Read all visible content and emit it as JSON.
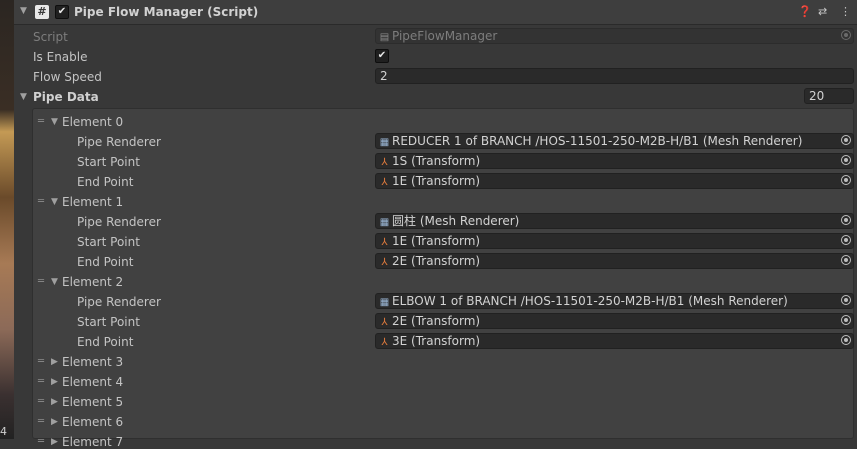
{
  "component": {
    "title": "Pipe Flow Manager (Script)",
    "enabled": true,
    "icons": {
      "help": "question-circle-icon",
      "presets": "sliders-icon",
      "menu": "kebab-menu-icon"
    }
  },
  "fields": {
    "script": {
      "label": "Script",
      "value": "PipeFlowManager"
    },
    "is_enable": {
      "label": "Is Enable",
      "checked": true
    },
    "flow_speed": {
      "label": "Flow Speed",
      "value": "2"
    },
    "pipe_data": {
      "label": "Pipe Data",
      "size": "20"
    }
  },
  "elements": [
    {
      "label": "Element 0",
      "expanded": true,
      "props": [
        {
          "label": "Pipe Renderer",
          "value": "REDUCER 1 of BRANCH /HOS-11501-250-M2B-H/B1 (Mesh Renderer)",
          "icon": "mesh-renderer-icon"
        },
        {
          "label": "Start Point",
          "value": "1S (Transform)",
          "icon": "transform-icon"
        },
        {
          "label": "End Point",
          "value": "1E (Transform)",
          "icon": "transform-icon"
        }
      ]
    },
    {
      "label": "Element 1",
      "expanded": true,
      "props": [
        {
          "label": "Pipe Renderer",
          "value": "圆柱 (Mesh Renderer)",
          "icon": "mesh-renderer-icon"
        },
        {
          "label": "Start Point",
          "value": "1E (Transform)",
          "icon": "transform-icon"
        },
        {
          "label": "End Point",
          "value": "2E (Transform)",
          "icon": "transform-icon"
        }
      ]
    },
    {
      "label": "Element 2",
      "expanded": true,
      "props": [
        {
          "label": "Pipe Renderer",
          "value": "ELBOW 1 of BRANCH /HOS-11501-250-M2B-H/B1 (Mesh Renderer)",
          "icon": "mesh-renderer-icon"
        },
        {
          "label": "Start Point",
          "value": "2E (Transform)",
          "icon": "transform-icon"
        },
        {
          "label": "End Point",
          "value": "3E (Transform)",
          "icon": "transform-icon"
        }
      ]
    },
    {
      "label": "Element 3",
      "expanded": false
    },
    {
      "label": "Element 4",
      "expanded": false
    },
    {
      "label": "Element 5",
      "expanded": false
    },
    {
      "label": "Element 6",
      "expanded": false
    },
    {
      "label": "Element 7",
      "expanded": false
    }
  ],
  "scene_view": {
    "visible_number": "4"
  }
}
